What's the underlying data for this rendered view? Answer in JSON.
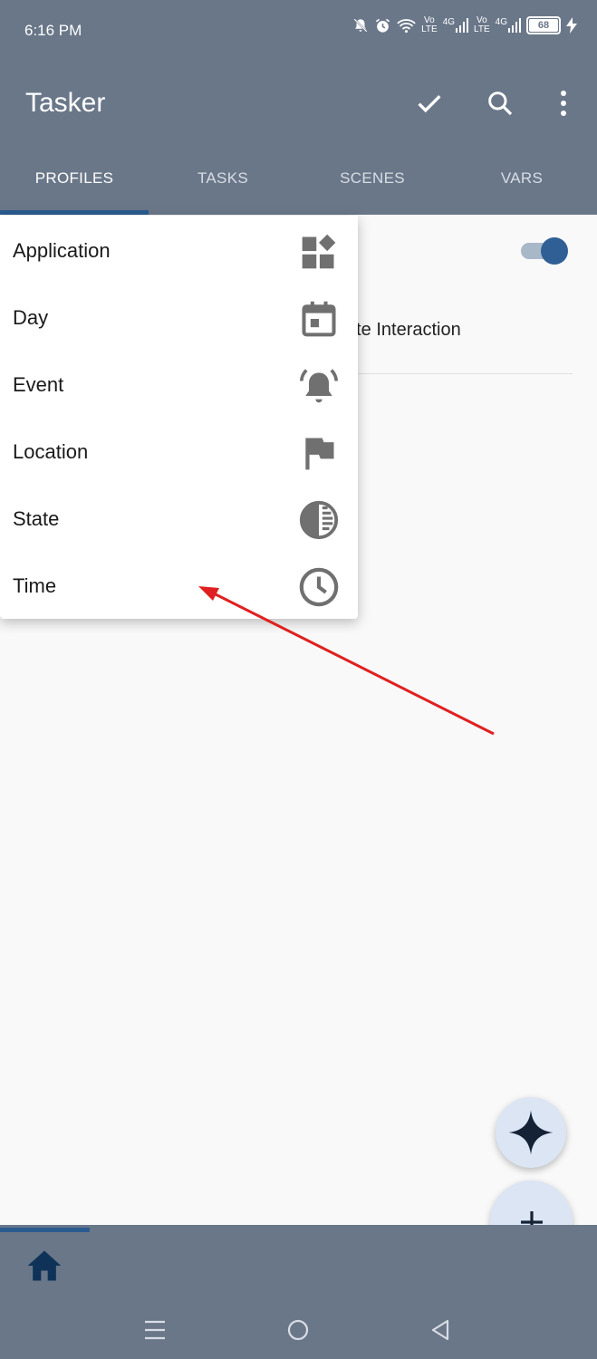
{
  "status_bar": {
    "time": "6:16 PM",
    "net1_top": "Vo",
    "net1_bottom": "LTE",
    "sig1": "4G",
    "net2_top": "Vo",
    "net2_bottom": "LTE",
    "sig2": "4G",
    "battery": "68"
  },
  "app": {
    "title": "Tasker",
    "icons": {
      "confirm": "check-icon",
      "search": "search-icon",
      "more": "more-vert-icon"
    }
  },
  "tabs": [
    {
      "label": "PROFILES",
      "active": true
    },
    {
      "label": "TASKS"
    },
    {
      "label": "SCENES"
    },
    {
      "label": "VARS"
    }
  ],
  "background": {
    "row_text": "ate Interaction",
    "toggle_on": true
  },
  "menu": {
    "items": [
      {
        "label": "Application",
        "icon": "widgets-icon"
      },
      {
        "label": "Day",
        "icon": "calendar-icon"
      },
      {
        "label": "Event",
        "icon": "alarm-bell-icon"
      },
      {
        "label": "Location",
        "icon": "flag-icon"
      },
      {
        "label": "State",
        "icon": "contrast-icon"
      },
      {
        "label": "Time",
        "icon": "clock-icon"
      }
    ]
  },
  "fabs": {
    "ai": "sparkle-icon",
    "add": "plus-icon"
  },
  "bottom_bar": {
    "home": "home-icon"
  },
  "nav_bar": {
    "menu": "menu-lines-icon",
    "home": "circle-home-icon",
    "back": "triangle-back-icon"
  },
  "colors": {
    "appbar": "#6a7789",
    "accent": "#2a5b8f",
    "annotation_arrow": "#e02020"
  }
}
